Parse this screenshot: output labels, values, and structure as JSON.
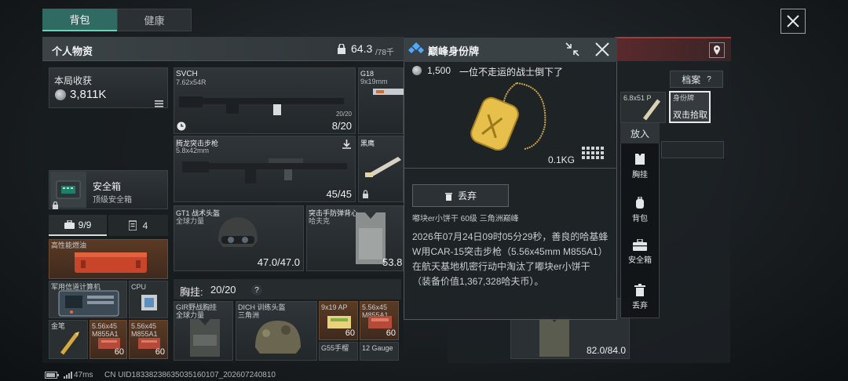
{
  "tabs": {
    "backpack": "背包",
    "health": "健康"
  },
  "personal": {
    "title": "个人物资",
    "weight": "64.3",
    "weight_max": "/78千"
  },
  "harvest": {
    "label": "本局收获",
    "value": "3,811K"
  },
  "safe_box": {
    "title": "安全箱",
    "subtitle": "顶级安全箱"
  },
  "counters": {
    "case": "9/9",
    "ammo": "4"
  },
  "stash": [
    {
      "label": "高性能燃油"
    },
    {
      "label": "军用信道计算机"
    },
    {
      "label": "CPU"
    },
    {
      "label": "金笔"
    },
    {
      "label": "5.56x45 M855A1",
      "count": "60"
    },
    {
      "label": "5.56x45 M855A1",
      "count": "60"
    }
  ],
  "weapons": [
    {
      "name": "SVCH",
      "caliber": "7.62x54R",
      "ammo_small": "20/20",
      "ammo": "8/20"
    },
    {
      "name": "G18",
      "caliber": "9x19mm"
    },
    {
      "name": "腾龙突击步枪",
      "caliber": "5.8x42mm",
      "ammo": "45/45"
    },
    {
      "name": "黑鹰"
    }
  ],
  "helmet": {
    "name": "GT1 战术头盔",
    "sub": "全球力量",
    "value": "47.0/47.0"
  },
  "armor": {
    "name": "突击手防弹背心",
    "sub": "哈夫克",
    "value": "53.8"
  },
  "rig": {
    "label": "胸挂:",
    "value": "20/20",
    "help": "?"
  },
  "rig_items": [
    {
      "name": "GIR野战胸挂",
      "sub": "全球力量"
    },
    {
      "name": "DICH 训练头盔",
      "sub": "三角洲"
    }
  ],
  "rig_ammo": [
    {
      "label": "9x19 AP",
      "count": "60"
    },
    {
      "label": "5.56x45 M855A1",
      "count": "60"
    },
    {
      "label": "G55手榴"
    },
    {
      "label": "12 Gauge"
    }
  ],
  "right": {
    "archive": "档案",
    "archive_help": "?",
    "partial": "6.8x51 P",
    "tag_title": "身份牌",
    "tag_hint": "双击拾取",
    "bottom_value": "82.0/84.0"
  },
  "popup": {
    "title": "巅峰身份牌",
    "price": "1,500",
    "subtitle": "一位不走运的战士倒下了",
    "weight": "0.1KG",
    "discard": "丢弃",
    "meta": "嘟块er小饼干   60级   三角洲巅峰",
    "description": "2026年07月24日09时05分29秒，善良的哈基蜂W用CAR-15突击步枪（5.56x45mm M855A1）在航天基地机密行动中淘汰了嘟块er小饼干（装备价值1,367,328哈夫币）。"
  },
  "menu": {
    "place": "放入",
    "chest": "胸挂",
    "backpack": "背包",
    "safe": "安全箱",
    "discard": "丢弃"
  },
  "status": {
    "ping": "47ms",
    "uid": "CN UID1833823863503516010​7_202607240810"
  },
  "icons": [
    "close-icon",
    "lock-icon",
    "grid-icon",
    "download-icon",
    "diamond-icon",
    "shrink-icon",
    "location-icon",
    "trash-icon",
    "vest-icon",
    "backpack-icon",
    "safe-icon",
    "battery-icon",
    "signal-icon",
    "clock-icon"
  ]
}
